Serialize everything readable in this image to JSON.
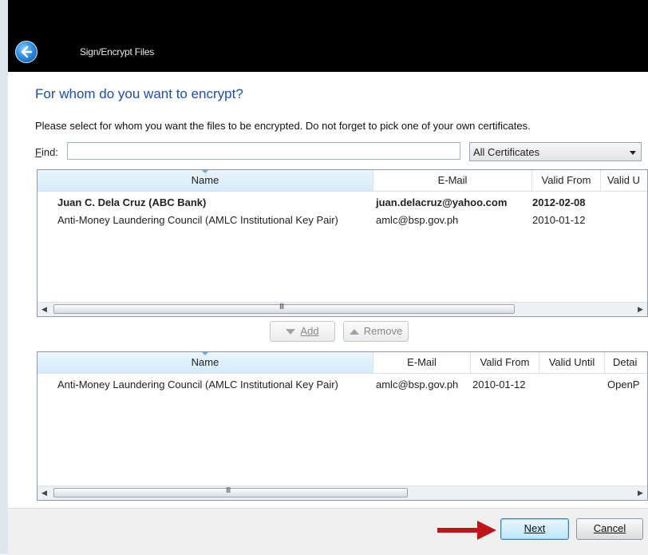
{
  "window": {
    "title": "Sign/Encrypt Files"
  },
  "page": {
    "heading": "For whom do you want to encrypt?",
    "instruction": "Please select for whom you want the files to be encrypted. Do not forget to pick one of your own certificates."
  },
  "find": {
    "label": "Find:",
    "value": ""
  },
  "filter": {
    "selected": "All Certificates"
  },
  "available": {
    "columns": [
      "Name",
      "E-Mail",
      "Valid From",
      "Valid U"
    ],
    "rows": [
      {
        "name": "Juan C. Dela Cruz (ABC Bank)",
        "email": "juan.delacruz@yahoo.com",
        "valid_from": "2012-02-08"
      },
      {
        "name": "Anti-Money Laundering Council (AMLC Institutional Key Pair)",
        "email": "amlc@bsp.gov.ph",
        "valid_from": "2010-01-12"
      }
    ]
  },
  "buttons": {
    "add": "Add",
    "remove": "Remove",
    "next": "Next",
    "cancel": "Cancel"
  },
  "selected": {
    "columns": [
      "Name",
      "E-Mail",
      "Valid From",
      "Valid Until",
      "Detai"
    ],
    "rows": [
      {
        "name": "Anti-Money Laundering Council (AMLC Institutional Key Pair)",
        "email": "amlc@bsp.gov.ph",
        "valid_from": "2010-01-12",
        "valid_until": "",
        "details": "OpenP"
      }
    ]
  },
  "scrollbar": {
    "grip": "III"
  },
  "colors": {
    "heading": "#1e4fa0",
    "titlebar": "#000000",
    "arrow": "#c0141a",
    "primary_button": "#bee6fd"
  },
  "icons": {
    "back": "back-arrow-icon",
    "add": "arrow-down-icon",
    "remove": "arrow-up-icon"
  }
}
